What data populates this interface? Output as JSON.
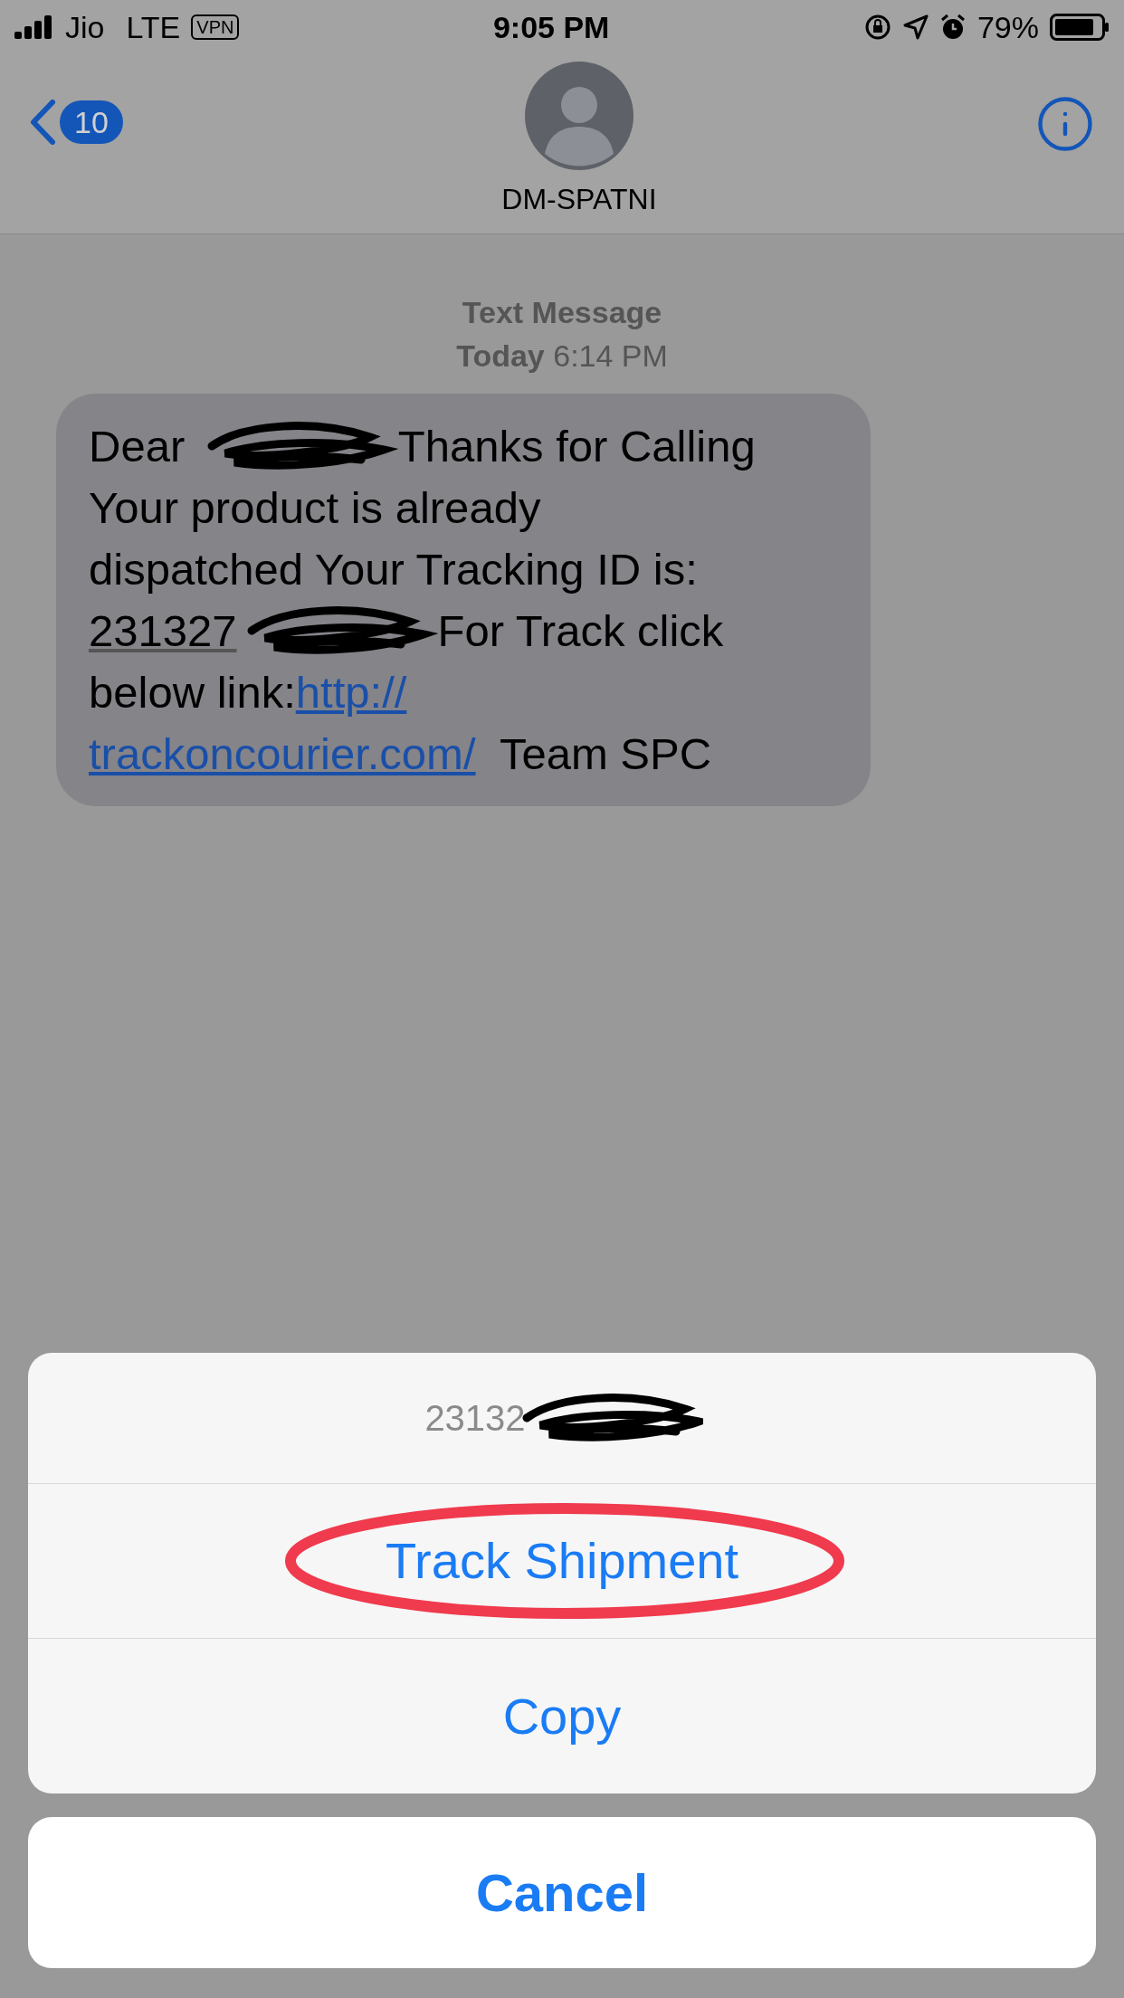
{
  "status_bar": {
    "carrier": "Jio",
    "network": "LTE",
    "vpn": "VPN",
    "time": "9:05 PM",
    "battery": "79%"
  },
  "nav": {
    "back_count": "10",
    "contact": "DM-SPATNI"
  },
  "thread": {
    "kind_label": "Text Message",
    "day": "Today",
    "time": "6:14 PM"
  },
  "message": {
    "lines": [
      [
        {
          "kind": "text",
          "text": "Dear "
        },
        {
          "kind": "redaction"
        },
        {
          "kind": "text",
          "text": "Thanks for Calling"
        }
      ],
      [
        {
          "kind": "text",
          "text": "Your product is already"
        }
      ],
      [
        {
          "kind": "text",
          "text": "dispatched Your Tracking ID is:"
        }
      ],
      [
        {
          "kind": "detected",
          "text": "231327"
        },
        {
          "kind": "redaction"
        },
        {
          "kind": "text",
          "text": "For Track click"
        }
      ],
      [
        {
          "kind": "text",
          "text": "below link:"
        },
        {
          "kind": "link",
          "text": "http://"
        }
      ],
      [
        {
          "kind": "link",
          "text": "trackoncourier.com/"
        },
        {
          "kind": "text",
          "text": "  Team SPC"
        }
      ]
    ]
  },
  "action_sheet": {
    "title": "23132",
    "title_redacted": true,
    "actions": [
      {
        "label": "Track Shipment",
        "circled": true
      },
      {
        "label": "Copy",
        "circled": false
      }
    ],
    "cancel": "Cancel"
  }
}
